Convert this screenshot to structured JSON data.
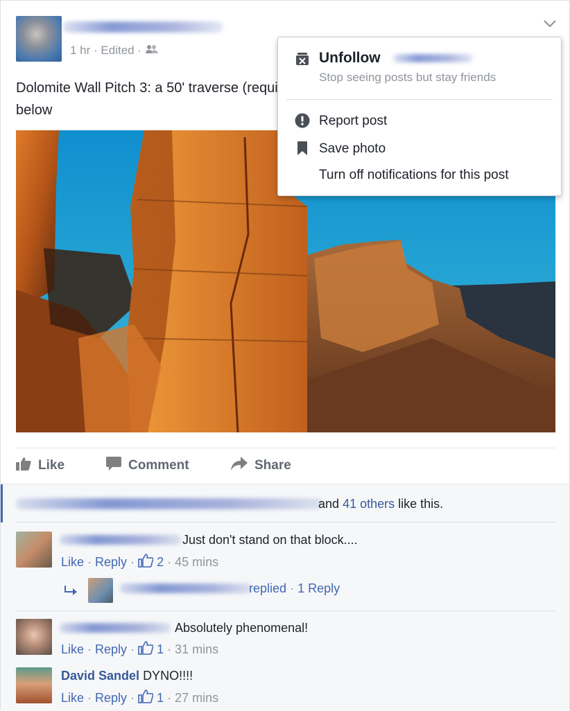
{
  "post": {
    "timestamp": "1 hr",
    "edited": "Edited",
    "text": "Dolomite Wall Pitch 3: a 50' traverse (requires an arm-bar no less) and a 300' drop below"
  },
  "actions": {
    "like": "Like",
    "comment": "Comment",
    "share": "Share"
  },
  "menu": {
    "unfollow_label": "Unfollow",
    "unfollow_sub": "Stop seeing posts but stay friends",
    "report_label": "Report post",
    "save_label": "Save photo",
    "notifications_label": "Turn off notifications for this post"
  },
  "likes": {
    "prefix": "and",
    "others": "41 others",
    "suffix": "like this."
  },
  "comments": [
    {
      "text": "Just don't stand on that block....",
      "like": "Like",
      "reply": "Reply",
      "count": "2",
      "time": "45 mins"
    },
    {
      "text": "Absolutely phenomenal!",
      "like": "Like",
      "reply": "Reply",
      "count": "1",
      "time": "31 mins"
    },
    {
      "name": "David Sandel",
      "text": "DYNO!!!!",
      "like": "Like",
      "reply": "Reply",
      "count": "1",
      "time": "27 mins"
    }
  ],
  "reply": {
    "replied": "replied",
    "count_label": "1 Reply"
  },
  "colors": {
    "link": "#365899",
    "meta": "#90949c",
    "comments_bg": "#f6f7f9"
  }
}
